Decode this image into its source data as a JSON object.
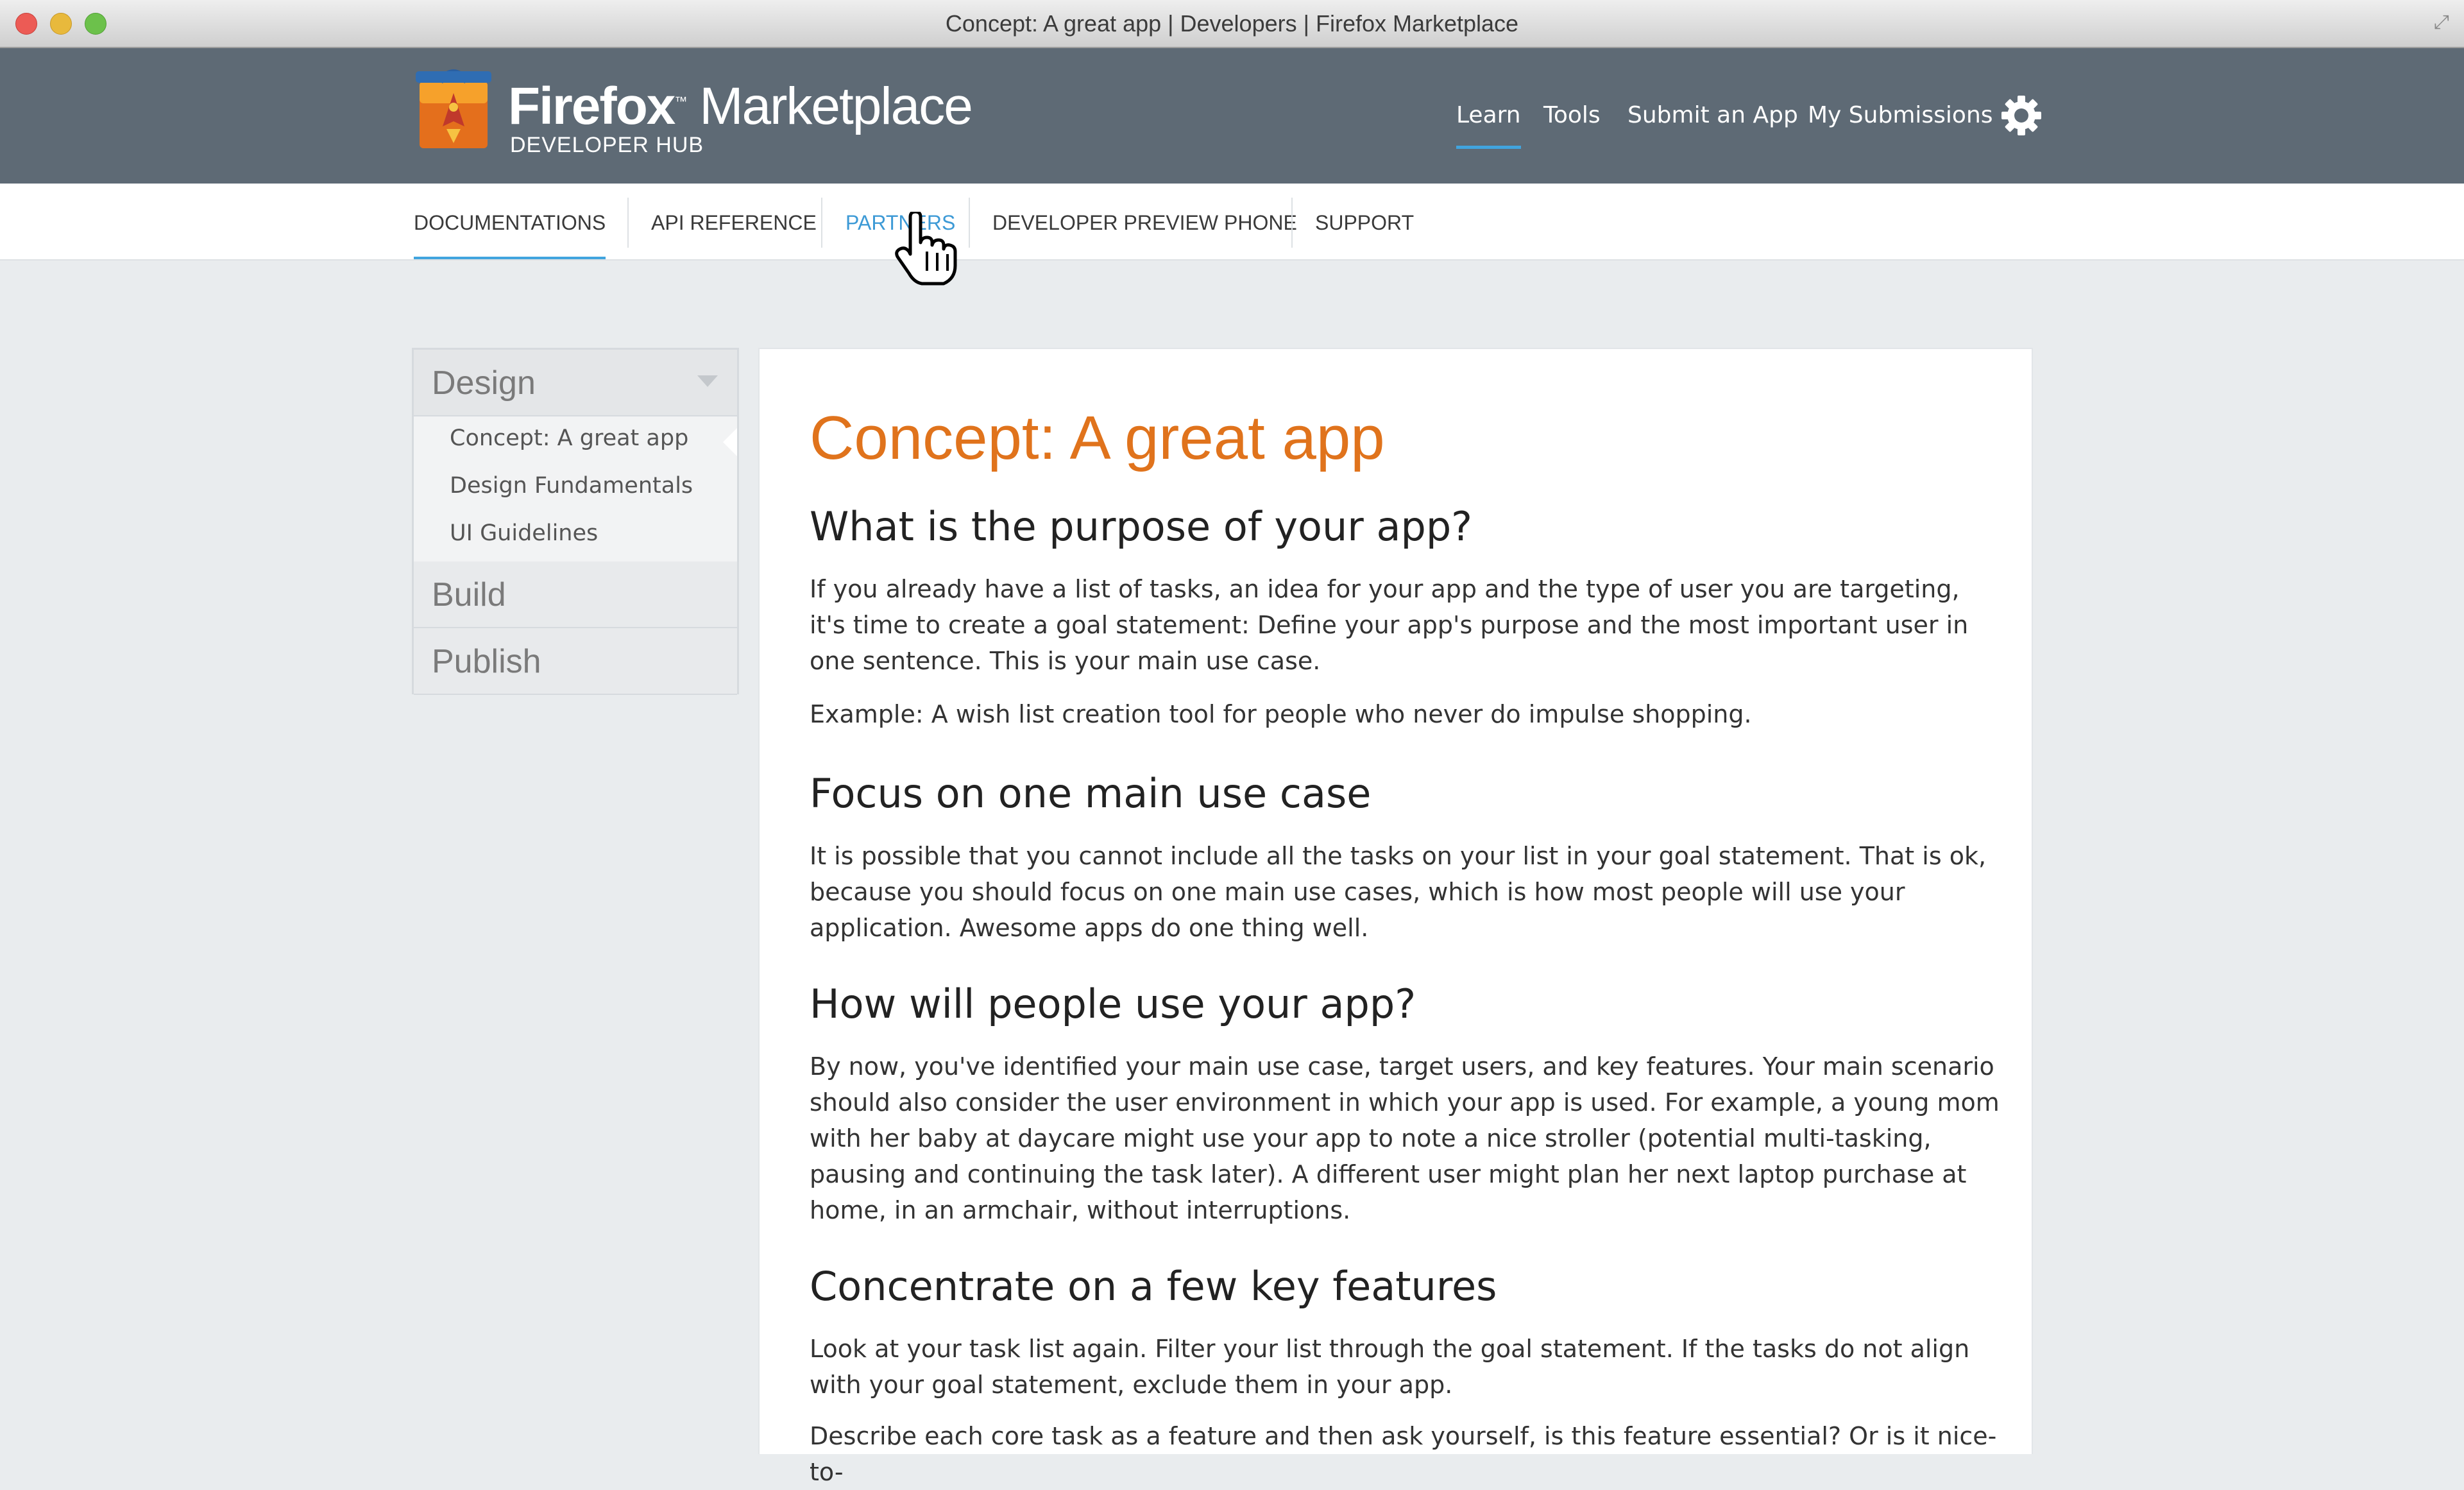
{
  "window": {
    "title": "Concept: A great app | Developers | Firefox Marketplace"
  },
  "brand": {
    "name_bold": "Firefox",
    "name_light": "Marketplace",
    "subtitle": "DEVELOPER HUB"
  },
  "top_nav": {
    "items": [
      "Learn",
      "Tools",
      "Submit an App",
      "My Submissions"
    ],
    "active": "Learn"
  },
  "sub_nav": {
    "items": [
      "DOCUMENTATIONS",
      "API REFERENCE",
      "PARTNERS",
      "DEVELOPER PREVIEW PHONE",
      "SUPPORT"
    ],
    "active": "DOCUMENTATIONS",
    "hovered": "PARTNERS"
  },
  "sidebar": {
    "sections": [
      {
        "title": "Design",
        "expanded": true,
        "items": [
          "Concept: A great app",
          "Design Fundamentals",
          "UI Guidelines"
        ]
      },
      {
        "title": "Build",
        "expanded": false
      },
      {
        "title": "Publish",
        "expanded": false
      }
    ]
  },
  "content": {
    "title": "Concept: A great app",
    "sections": [
      {
        "heading": "What is the purpose of your app?",
        "paragraphs": [
          "If you already have a list of tasks, an idea for your app and the type of user you are targeting, it's time to create a goal statement: Define your app's purpose and the most important user in one sentence. This is your main use case.",
          "Example: A wish list creation tool for people who never do impulse shopping."
        ]
      },
      {
        "heading": "Focus on one main use case",
        "paragraphs": [
          "It is possible that you cannot include all the tasks on your list in your goal statement. That is ok, because you should focus on one main use cases, which is how most people will use your application. Awesome apps do one thing well."
        ]
      },
      {
        "heading": "How will people use your app?",
        "paragraphs": [
          "By now, you've identified your main use case, target users, and key features. Your main scenario should also consider the user environment in which your app is used. For example, a young mom with her baby at daycare might use your app to note a nice stroller (potential multi-tasking, pausing and continuing the task later). A different user might plan her next laptop purchase at home, in an armchair, without interruptions."
        ]
      },
      {
        "heading": "Concentrate on a few key features",
        "paragraphs": [
          "Look at your task list again. Filter your list through the goal statement. If the tasks do not align with your goal statement, exclude them in your app.",
          "Describe each core task as a feature and then ask yourself, is this feature essential? Or is it nice-to-"
        ]
      }
    ]
  },
  "colors": {
    "header": "#5e6a75",
    "accent": "#41a4de",
    "title": "#e0731c"
  }
}
